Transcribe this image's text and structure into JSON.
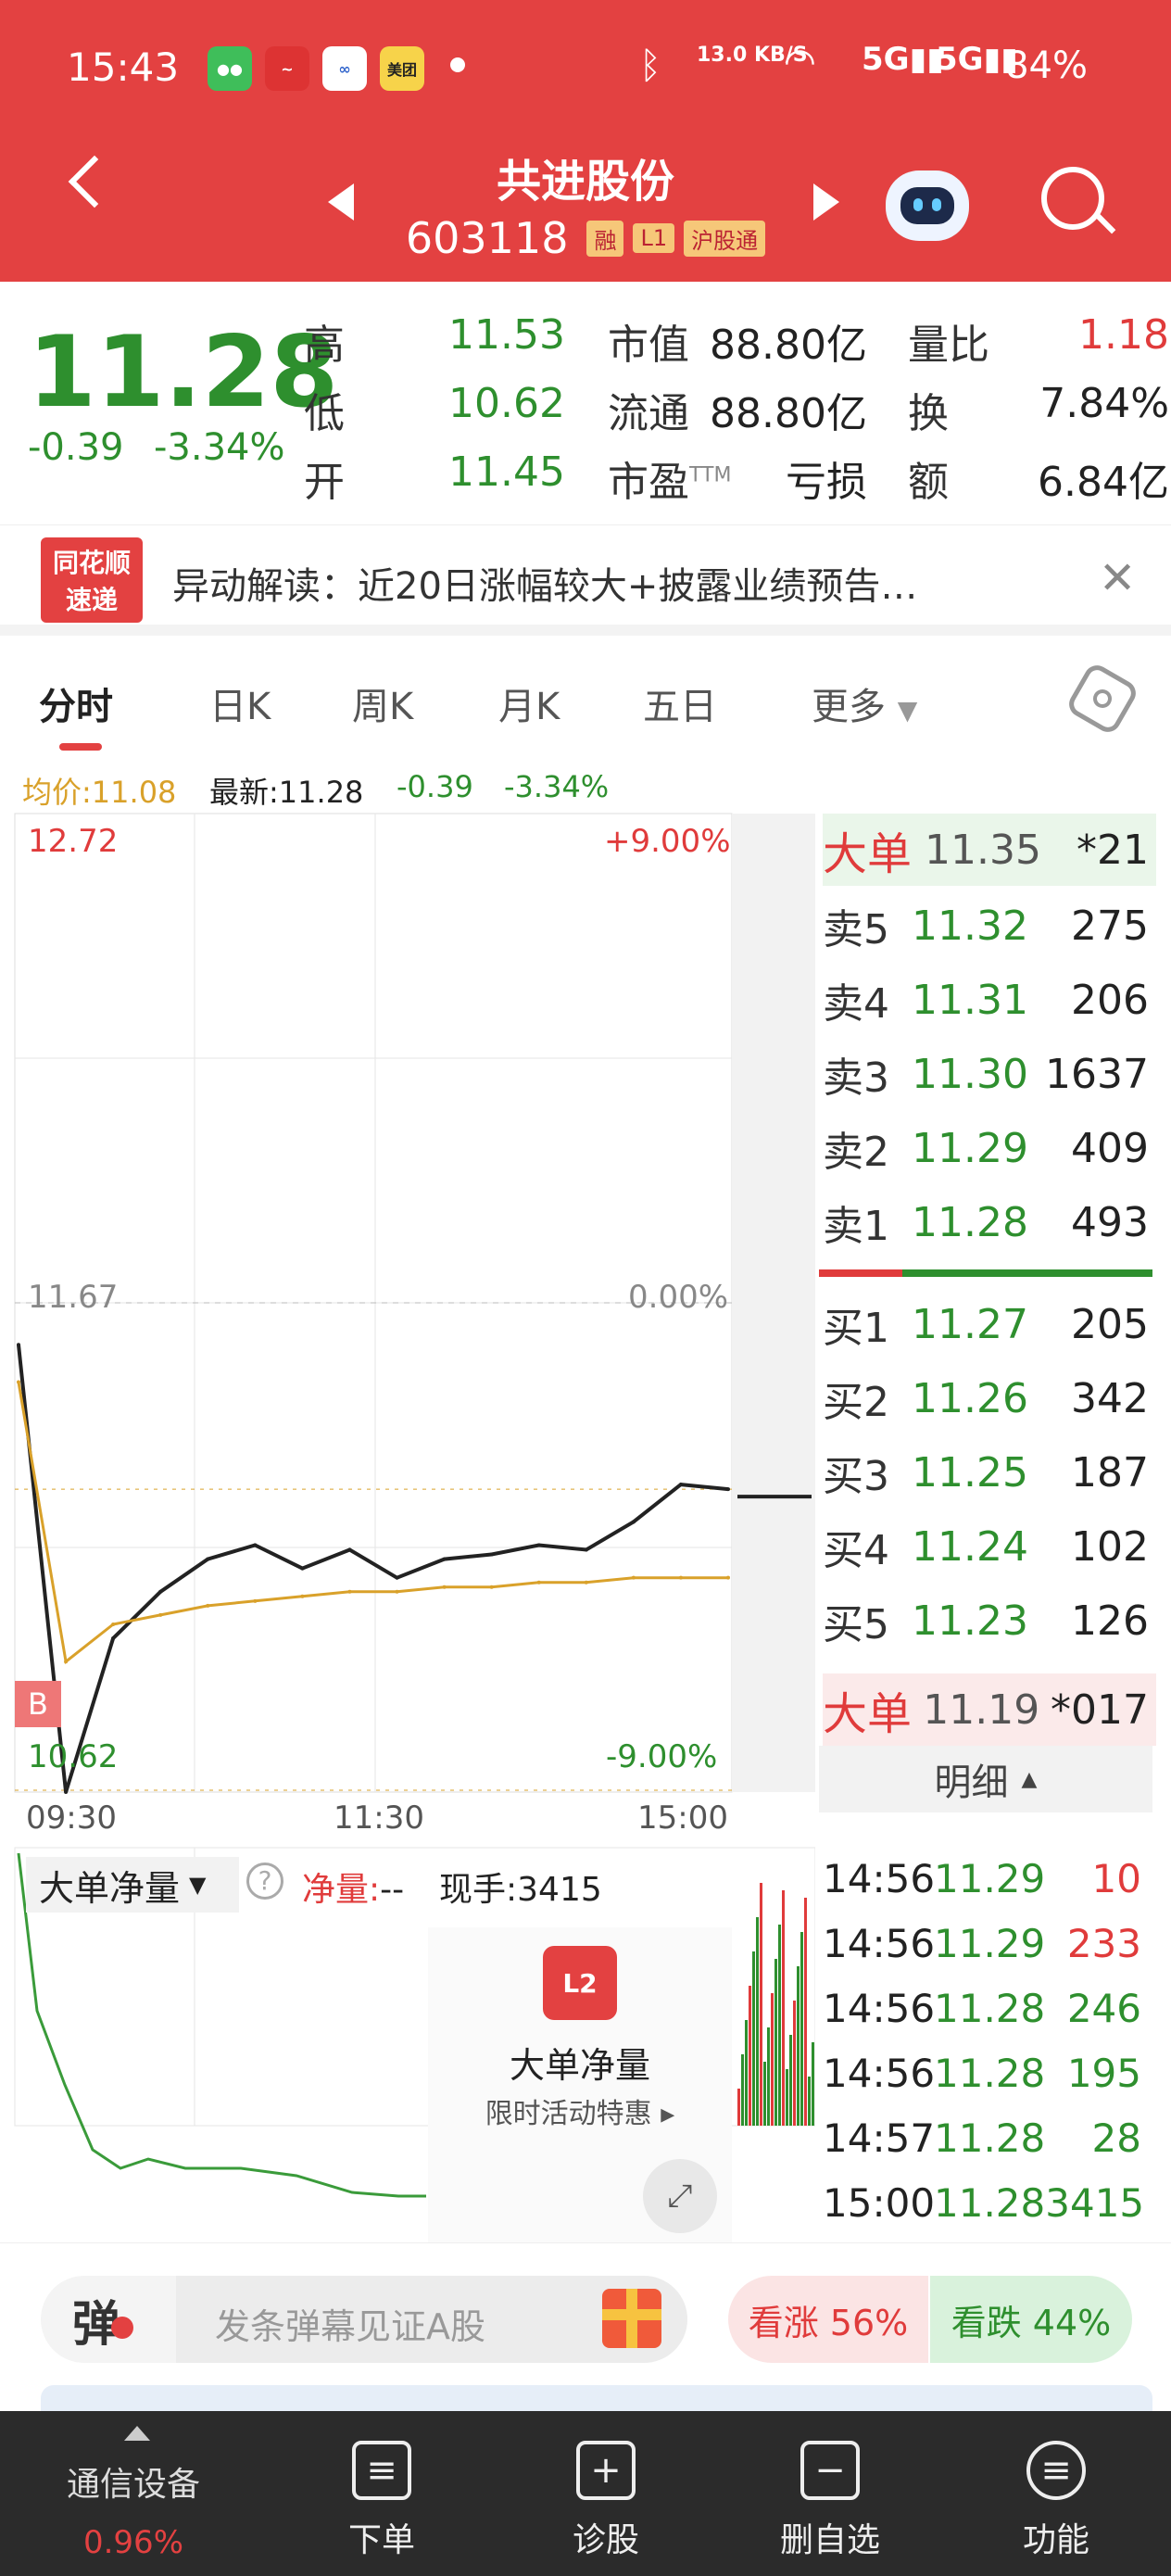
{
  "status": {
    "time": "15:43",
    "network": "13.0 KB/S",
    "battery": "84%",
    "meituan": "美团"
  },
  "header": {
    "title": "共进股份",
    "code": "603118",
    "tags": [
      "融",
      "L1",
      "沪股通"
    ]
  },
  "quote": {
    "price": "11.28",
    "change": "-0.39",
    "change_pct": "-3.34%",
    "high_label": "高",
    "high": "11.53",
    "low_label": "低",
    "low": "10.62",
    "open_label": "开",
    "open": "11.45",
    "mcap_label": "市值",
    "mcap": "88.80亿",
    "float_label": "流通",
    "float": "88.80亿",
    "pe_label": "市盈",
    "pe_sup": "TTM",
    "pe": "亏损",
    "vr_label": "量比",
    "vr": "1.18",
    "turn_label": "换",
    "turn": "7.84%",
    "amt_label": "额",
    "amt": "6.84亿"
  },
  "notice": {
    "logo_top": "同花顺",
    "logo_bottom": "速递",
    "text": "异动解读：近20日涨幅较大+披露业绩预告…"
  },
  "tabs": [
    "分时",
    "日K",
    "周K",
    "月K",
    "五日",
    "更多"
  ],
  "info": {
    "avg_label": "均价:",
    "avg": "11.08",
    "last_label": "最新:",
    "last": "11.28",
    "chg": "-0.39",
    "pct": "-3.34%"
  },
  "chart": {
    "top_price": "12.72",
    "top_pct": "+9.00%",
    "mid_price": "11.67",
    "mid_pct": "0.00%",
    "bot_price": "10.62",
    "bot_pct": "-9.00%",
    "times": [
      "09:30",
      "11:30",
      "15:00"
    ],
    "b_marker": "B"
  },
  "chart_data": {
    "type": "line",
    "ylim": [
      10.62,
      12.72
    ],
    "x": [
      "09:30",
      "11:30",
      "15:00"
    ],
    "series": [
      {
        "values": [
          11.58,
          10.62,
          10.95,
          11.05,
          11.12,
          11.15,
          11.1,
          11.14,
          11.08,
          11.12,
          11.13,
          11.15,
          11.14,
          11.2,
          11.28,
          11.27
        ]
      },
      {
        "name": "均价",
        "values": [
          11.5,
          10.9,
          10.98,
          11.0,
          11.02,
          11.03,
          11.04,
          11.05,
          11.05,
          11.06,
          11.06,
          11.07,
          11.07,
          11.08,
          11.08,
          11.08
        ]
      }
    ]
  },
  "orderbook": {
    "big_sell": {
      "label": "大单",
      "price": "11.35",
      "vol": "*21"
    },
    "asks": [
      {
        "side": "卖5",
        "price": "11.32",
        "vol": "275",
        "bar": 0.15
      },
      {
        "side": "卖4",
        "price": "11.31",
        "vol": "206",
        "bar": 0.12
      },
      {
        "side": "卖3",
        "price": "11.30",
        "vol": "1637",
        "bar": 1.0
      },
      {
        "side": "卖2",
        "price": "11.29",
        "vol": "409",
        "bar": 0.25
      },
      {
        "side": "卖1",
        "price": "11.28",
        "vol": "493",
        "bar": 0.3
      }
    ],
    "bids": [
      {
        "side": "买1",
        "price": "11.27",
        "vol": "205"
      },
      {
        "side": "买2",
        "price": "11.26",
        "vol": "342"
      },
      {
        "side": "买3",
        "price": "11.25",
        "vol": "187"
      },
      {
        "side": "买4",
        "price": "11.24",
        "vol": "102"
      },
      {
        "side": "买5",
        "price": "11.23",
        "vol": "126"
      }
    ],
    "big_buy": {
      "label": "大单",
      "price": "11.19",
      "vol": "*017"
    },
    "detail_label": "明细"
  },
  "details": [
    {
      "time": "14:56",
      "price": "11.29",
      "vol": "10",
      "dir": "red"
    },
    {
      "time": "14:56",
      "price": "11.29",
      "vol": "233",
      "dir": "red"
    },
    {
      "time": "14:56",
      "price": "11.28",
      "vol": "246",
      "dir": "green"
    },
    {
      "time": "14:56",
      "price": "11.28",
      "vol": "195",
      "dir": "green"
    },
    {
      "time": "14:57",
      "price": "11.28",
      "vol": "28",
      "dir": "green"
    },
    {
      "time": "15:00",
      "price": "11.28",
      "vol": "3415",
      "dir": "green"
    }
  ],
  "netflow": {
    "selector": "大单净量",
    "net_label": "净量:",
    "net_value": "--",
    "hand": "现手:3415",
    "promo_title": "大单净量",
    "promo_sub": "限时活动特惠",
    "promo_icon": "L2"
  },
  "comment": {
    "icon": "弹",
    "placeholder": "发条弹幕见证A股",
    "up": "看涨 56%",
    "down": "看跌 44%"
  },
  "nav": {
    "sector": "通信设备",
    "sector_pct": "0.96%",
    "items": [
      "下单",
      "诊股",
      "删自选",
      "功能"
    ]
  },
  "colors": {
    "brand": "#e34141",
    "up": "#e03b3b",
    "down": "#2e8f2e",
    "avg": "#d9a12a"
  }
}
